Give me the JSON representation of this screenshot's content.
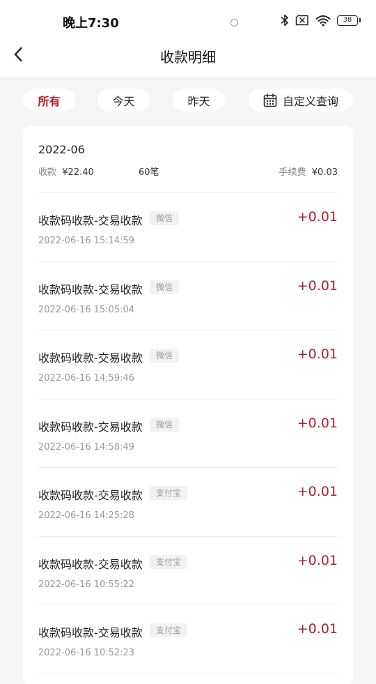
{
  "status_bar": {
    "time": "晚上7:30",
    "battery": "38",
    "icons": [
      "bluetooth-icon",
      "sim-error-icon",
      "wifi-icon",
      "battery-icon"
    ]
  },
  "nav": {
    "title": "收款明细",
    "back_icon": "chevron-left-icon"
  },
  "filters": {
    "all": "所有",
    "today": "今天",
    "yesterday": "昨天",
    "custom": "自定义查询",
    "custom_icon": "calendar-icon",
    "active": "all"
  },
  "summary": {
    "month": "2022-06",
    "received_label": "收款",
    "received_amount": "¥22.40",
    "count": "60笔",
    "fee_label": "手续费",
    "fee_amount": "¥0.03"
  },
  "transactions": [
    {
      "title": "收款码收款-交易收款",
      "tag": "微信",
      "time": "2022-06-16 15:14:59",
      "amount": "+0.01"
    },
    {
      "title": "收款码收款-交易收款",
      "tag": "微信",
      "time": "2022-06-16 15:05:04",
      "amount": "+0.01"
    },
    {
      "title": "收款码收款-交易收款",
      "tag": "微信",
      "time": "2022-06-16 14:59:46",
      "amount": "+0.01"
    },
    {
      "title": "收款码收款-交易收款",
      "tag": "微信",
      "time": "2022-06-16 14:58:49",
      "amount": "+0.01"
    },
    {
      "title": "收款码收款-交易收款",
      "tag": "支付宝",
      "time": "2022-06-16 14:25:28",
      "amount": "+0.01"
    },
    {
      "title": "收款码收款-交易收款",
      "tag": "支付宝",
      "time": "2022-06-16 10:55:22",
      "amount": "+0.01"
    },
    {
      "title": "收款码收款-交易收款",
      "tag": "支付宝",
      "time": "2022-06-16 10:52:23",
      "amount": "+0.01"
    }
  ],
  "colors": {
    "accent": "#b1212b",
    "background": "#f5f5f5",
    "card": "#ffffff"
  }
}
